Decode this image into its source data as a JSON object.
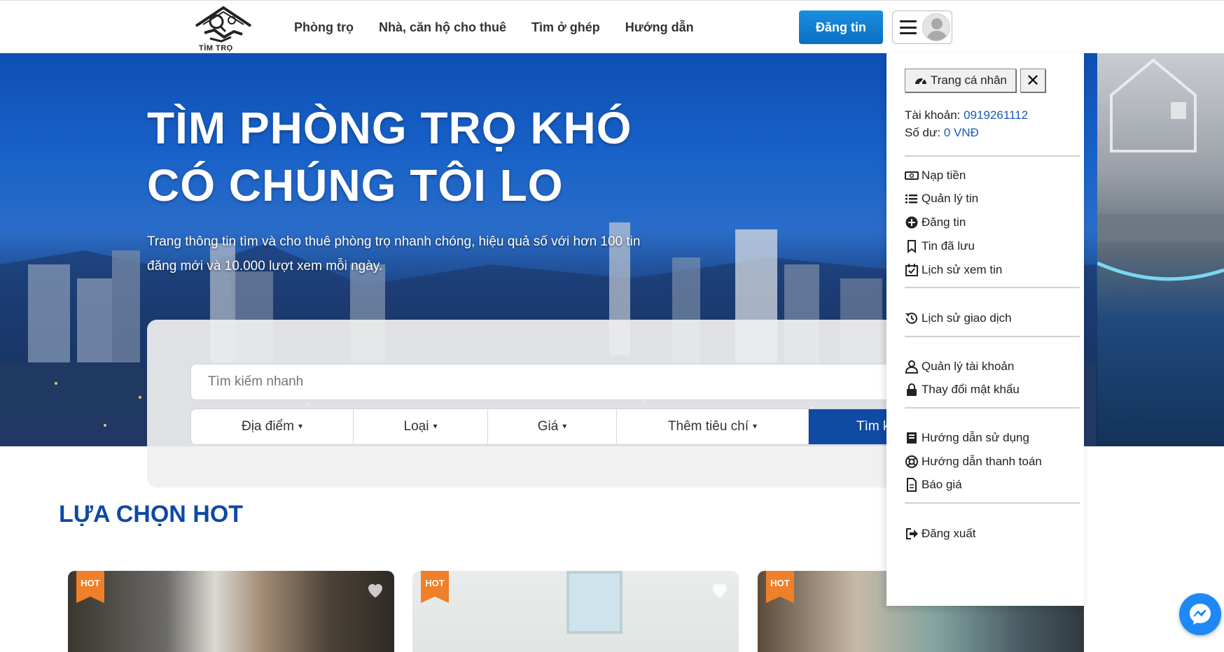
{
  "header": {
    "logo_text": "TÌM TRỌ",
    "nav": [
      "Phòng trọ",
      "Nhà, căn hộ cho thuê",
      "Tìm ở ghép",
      "Hướng dẫn"
    ],
    "post_button": "Đăng tin"
  },
  "hero": {
    "title_line1": "TÌM PHÒNG TRỌ KHÓ",
    "title_line2": "CÓ CHÚNG TÔI LO",
    "subtitle": "Trang thông tin tìm và cho thuê phòng trọ nhanh chóng, hiệu quả số với hơn 100 tin đăng mới và 10.000 lượt xem mỗi ngày."
  },
  "search": {
    "placeholder": "Tìm kiếm nhanh",
    "filters": [
      "Địa điểm",
      "Loại",
      "Giá",
      "Thêm tiêu chí"
    ],
    "button": "Tìm k"
  },
  "hot": {
    "title": "LỰA CHỌN HOT",
    "badge": "HOT"
  },
  "dropdown": {
    "profile_button": "Trang cá nhân",
    "close_label": "✕",
    "account_label": "Tài khoản:",
    "account_value": "0919261112",
    "balance_label": "Số dư:",
    "balance_value": "0 VNĐ",
    "items": [
      {
        "label": "Nạp tiền",
        "icon": "money-icon"
      },
      {
        "label": "Quản lý tin",
        "icon": "list-icon"
      },
      {
        "label": "Đăng tin",
        "icon": "plus-circle-icon"
      },
      {
        "label": "Tin đã lưu",
        "icon": "bookmark-icon"
      },
      {
        "label": "Lịch sử xem tin",
        "icon": "calendar-check-icon"
      },
      {
        "label": "Lịch sử giao dịch",
        "icon": "history-icon"
      },
      {
        "label": "Quản lý tài khoản",
        "icon": "user-icon"
      },
      {
        "label": "Thay đổi mật khẩu",
        "icon": "lock-icon"
      },
      {
        "label": "Hướng dẫn sử dụng",
        "icon": "book-icon"
      },
      {
        "label": "Hướng dẫn thanh toán",
        "icon": "lifebuoy-icon"
      },
      {
        "label": "Báo giá",
        "icon": "document-icon"
      },
      {
        "label": "Đăng xuất",
        "icon": "sign-out-icon"
      }
    ]
  },
  "colors": {
    "brand_blue": "#0f4aa3",
    "post_button": "#1a8ee0",
    "hot_badge": "#f07f2a",
    "link_value": "#1a5bb8"
  }
}
